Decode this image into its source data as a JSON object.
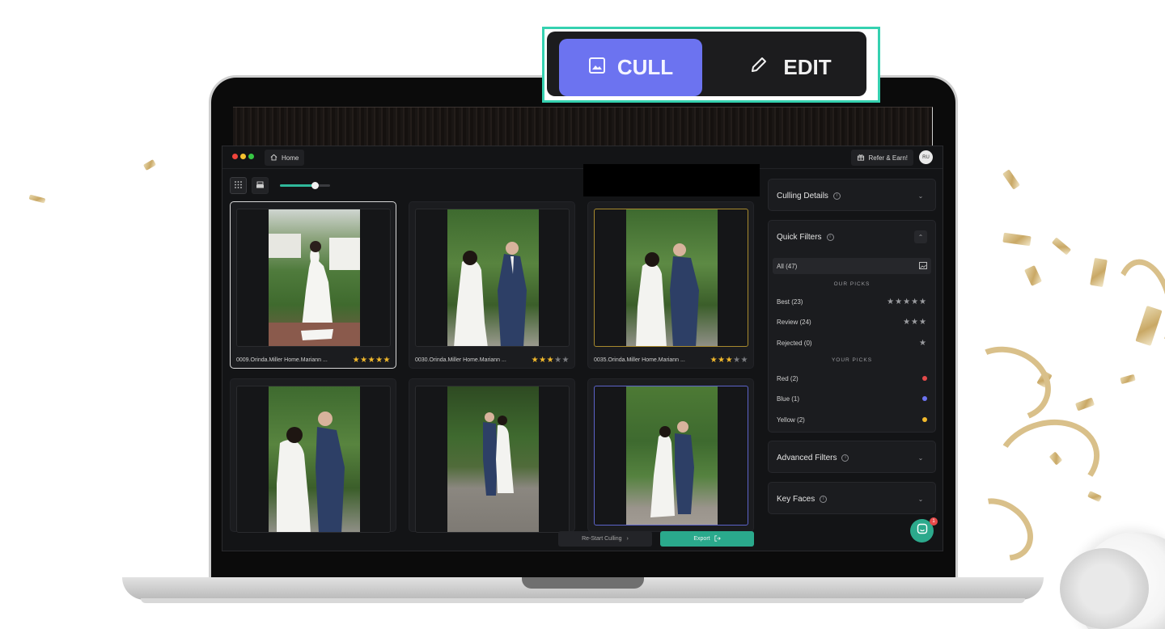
{
  "mode_switch": {
    "cull_label": "CULL",
    "edit_label": "EDIT",
    "active": "CULL"
  },
  "app": {
    "home_label": "Home",
    "refer_label": "Refer & Earn!",
    "avatar_initials": "RU",
    "zoom_slider_fraction": 0.7
  },
  "photos": [
    {
      "caption": "0009.Orinda.Miller Home.Mariann ...",
      "rating": 5,
      "selected": true,
      "color_tag": "none"
    },
    {
      "caption": "0030.Orinda.Miller Home.Mariann ...",
      "rating": 3,
      "selected": false,
      "color_tag": "none"
    },
    {
      "caption": "0035.Orinda.Miller Home.Mariann ...",
      "rating": 3,
      "selected": false,
      "color_tag": "yellow"
    },
    {
      "caption": "",
      "rating": 0,
      "selected": false,
      "color_tag": "none"
    },
    {
      "caption": "",
      "rating": 0,
      "selected": false,
      "color_tag": "none"
    },
    {
      "caption": "",
      "rating": 0,
      "selected": false,
      "color_tag": "blue"
    }
  ],
  "actions": {
    "restart_label": "Re-Start Culling",
    "export_label": "Export"
  },
  "panels": {
    "culling_details": "Culling Details",
    "quick_filters": {
      "title": "Quick Filters",
      "all": "All (47)",
      "our_picks_heading": "OUR PICKS",
      "best": "Best (23)",
      "review": "Review (24)",
      "rejected": "Rejected (0)",
      "your_picks_heading": "YOUR PICKS",
      "red": "Red (2)",
      "blue": "Blue (1)",
      "yellow": "Yellow (2)"
    },
    "advanced_filters": "Advanced Filters",
    "key_faces": "Key Faces"
  },
  "chat": {
    "badge": "1"
  },
  "colors": {
    "accent": "#6c73f0",
    "highlight_border": "#35d1b0",
    "export": "#2aa98c",
    "star": "#f2b92c",
    "red": "#e44a4a",
    "blue": "#6c73f0",
    "yellow": "#f2b92c"
  }
}
